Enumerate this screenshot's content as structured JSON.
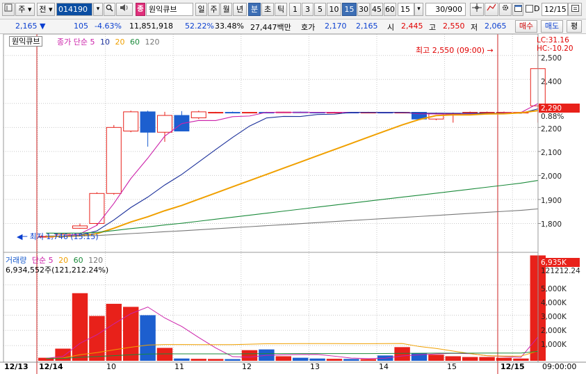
{
  "toolbar": {
    "market": "주",
    "price_mode": "전",
    "code": "014190",
    "stock_name": "원익큐브",
    "stock_tag": "종",
    "periods": [
      "일",
      "주",
      "월",
      "년",
      "분",
      "초",
      "틱"
    ],
    "active_period": "분",
    "intervals": [
      "1",
      "3",
      "5",
      "10",
      "15",
      "30",
      "45",
      "60"
    ],
    "active_interval": "15",
    "interval_value": "15",
    "count_value": "30/900",
    "date_value": "12/15",
    "d_label": "D"
  },
  "quote": {
    "price": "2,165",
    "change": "105",
    "change_pct": "-4.63%",
    "volume": "11,851,918",
    "vol_ratio": "52.22%",
    "turnover": "33.48%",
    "amount": "27,447백만",
    "bid_label": "호가",
    "ask": "2,170",
    "bid": "2,165",
    "open_label": "시",
    "open": "2,445",
    "high_label": "고",
    "high": "2,550",
    "low_label": "저",
    "low": "2,065",
    "buy_label": "매수",
    "sell_label": "매도",
    "eval_label": "평"
  },
  "price_panel": {
    "name": "원익큐브",
    "ma_label": "종가 단순",
    "ma_periods": [
      "5",
      "10",
      "20",
      "60",
      "120"
    ],
    "lc": "LC:31.16",
    "hc": "HC:-10.20",
    "max_label": "최고 2,550 (09:00)",
    "min_label": "최저 1,746 (15:15)",
    "last_price": "2,290",
    "last_pct": "0.88%",
    "y_ticks": [
      "2,500",
      "2,400",
      "2,300",
      "2,200",
      "2,100",
      "2,000",
      "1,900",
      "1,800"
    ]
  },
  "volume_panel": {
    "name": "거래량",
    "ma_label": "단순",
    "ma_periods": [
      "5",
      "20",
      "60",
      "120"
    ],
    "volume_text": "6,934,552주(121,212.24%)",
    "last_volume": "6,935K",
    "last_pct": "121212.24",
    "y_ticks": [
      "5,000K",
      "4,000K",
      "3,000K",
      "2,000K",
      "1,000K"
    ]
  },
  "x_axis": {
    "labels": [
      "12/13",
      "12/14",
      "10",
      "11",
      "12",
      "13",
      "14",
      "15",
      "12/15"
    ],
    "time": "09:00:00"
  },
  "colors": {
    "up": "#e8211a",
    "down": "#1d5fcf",
    "ma5": "#cc22aa",
    "ma10": "#1a2f9a",
    "ma20": "#f0a000",
    "ma60": "#1a8a3a",
    "ma120": "#777777"
  },
  "chart_data": {
    "type": "candlestick",
    "price_range": [
      1700,
      2560
    ],
    "volume_range": [
      0,
      7000
    ],
    "candles": [
      {
        "o": 1745,
        "h": 1750,
        "l": 1744,
        "c": 1746
      },
      {
        "o": 1746,
        "h": 1760,
        "l": 1745,
        "c": 1755
      },
      {
        "o": 1780,
        "h": 1800,
        "l": 1778,
        "c": 1790
      },
      {
        "o": 1800,
        "h": 1930,
        "l": 1790,
        "c": 1925
      },
      {
        "o": 1925,
        "h": 2210,
        "l": 1920,
        "c": 2200
      },
      {
        "o": 2185,
        "h": 2270,
        "l": 2180,
        "c": 2265
      },
      {
        "o": 2265,
        "h": 2270,
        "l": 2120,
        "c": 2180
      },
      {
        "o": 2180,
        "h": 2265,
        "l": 2140,
        "c": 2250
      },
      {
        "o": 2250,
        "h": 2268,
        "l": 2190,
        "c": 2185
      },
      {
        "o": 2240,
        "h": 2270,
        "l": 2235,
        "c": 2265
      },
      {
        "o": 2262,
        "h": 2265,
        "l": 2260,
        "c": 2263
      },
      {
        "o": 2263,
        "h": 2266,
        "l": 2260,
        "c": 2262
      },
      {
        "o": 2262,
        "h": 2264,
        "l": 2261,
        "c": 2263
      },
      {
        "o": 2263,
        "h": 2265,
        "l": 2262,
        "c": 2262
      },
      {
        "o": 2262,
        "h": 2265,
        "l": 2261,
        "c": 2264
      },
      {
        "o": 2264,
        "h": 2266,
        "l": 2262,
        "c": 2263
      },
      {
        "o": 2263,
        "h": 2264,
        "l": 2262,
        "c": 2262
      },
      {
        "o": 2262,
        "h": 2265,
        "l": 2261,
        "c": 2263
      },
      {
        "o": 2263,
        "h": 2264,
        "l": 2262,
        "c": 2262
      },
      {
        "o": 2262,
        "h": 2265,
        "l": 2261,
        "c": 2263
      },
      {
        "o": 2263,
        "h": 2264,
        "l": 2262,
        "c": 2262
      },
      {
        "o": 2262,
        "h": 2264,
        "l": 2260,
        "c": 2263
      },
      {
        "o": 2263,
        "h": 2264,
        "l": 2232,
        "c": 2235
      },
      {
        "o": 2235,
        "h": 2262,
        "l": 2230,
        "c": 2258
      },
      {
        "o": 2258,
        "h": 2262,
        "l": 2220,
        "c": 2258
      },
      {
        "o": 2262,
        "h": 2266,
        "l": 2261,
        "c": 2263
      },
      {
        "o": 2263,
        "h": 2266,
        "l": 2262,
        "c": 2263
      },
      {
        "o": 2263,
        "h": 2266,
        "l": 2262,
        "c": 2263
      },
      {
        "o": 2263,
        "h": 2265,
        "l": 2262,
        "c": 2263
      },
      {
        "o": 2290,
        "h": 2550,
        "l": 2220,
        "c": 2445
      }
    ],
    "volumes": [
      200,
      800,
      4450,
      2950,
      3750,
      3550,
      3000,
      850,
      150,
      130,
      120,
      110,
      700,
      750,
      300,
      200,
      150,
      130,
      120,
      110,
      350,
      900,
      500,
      400,
      300,
      250,
      250,
      200,
      150,
      6935
    ]
  }
}
